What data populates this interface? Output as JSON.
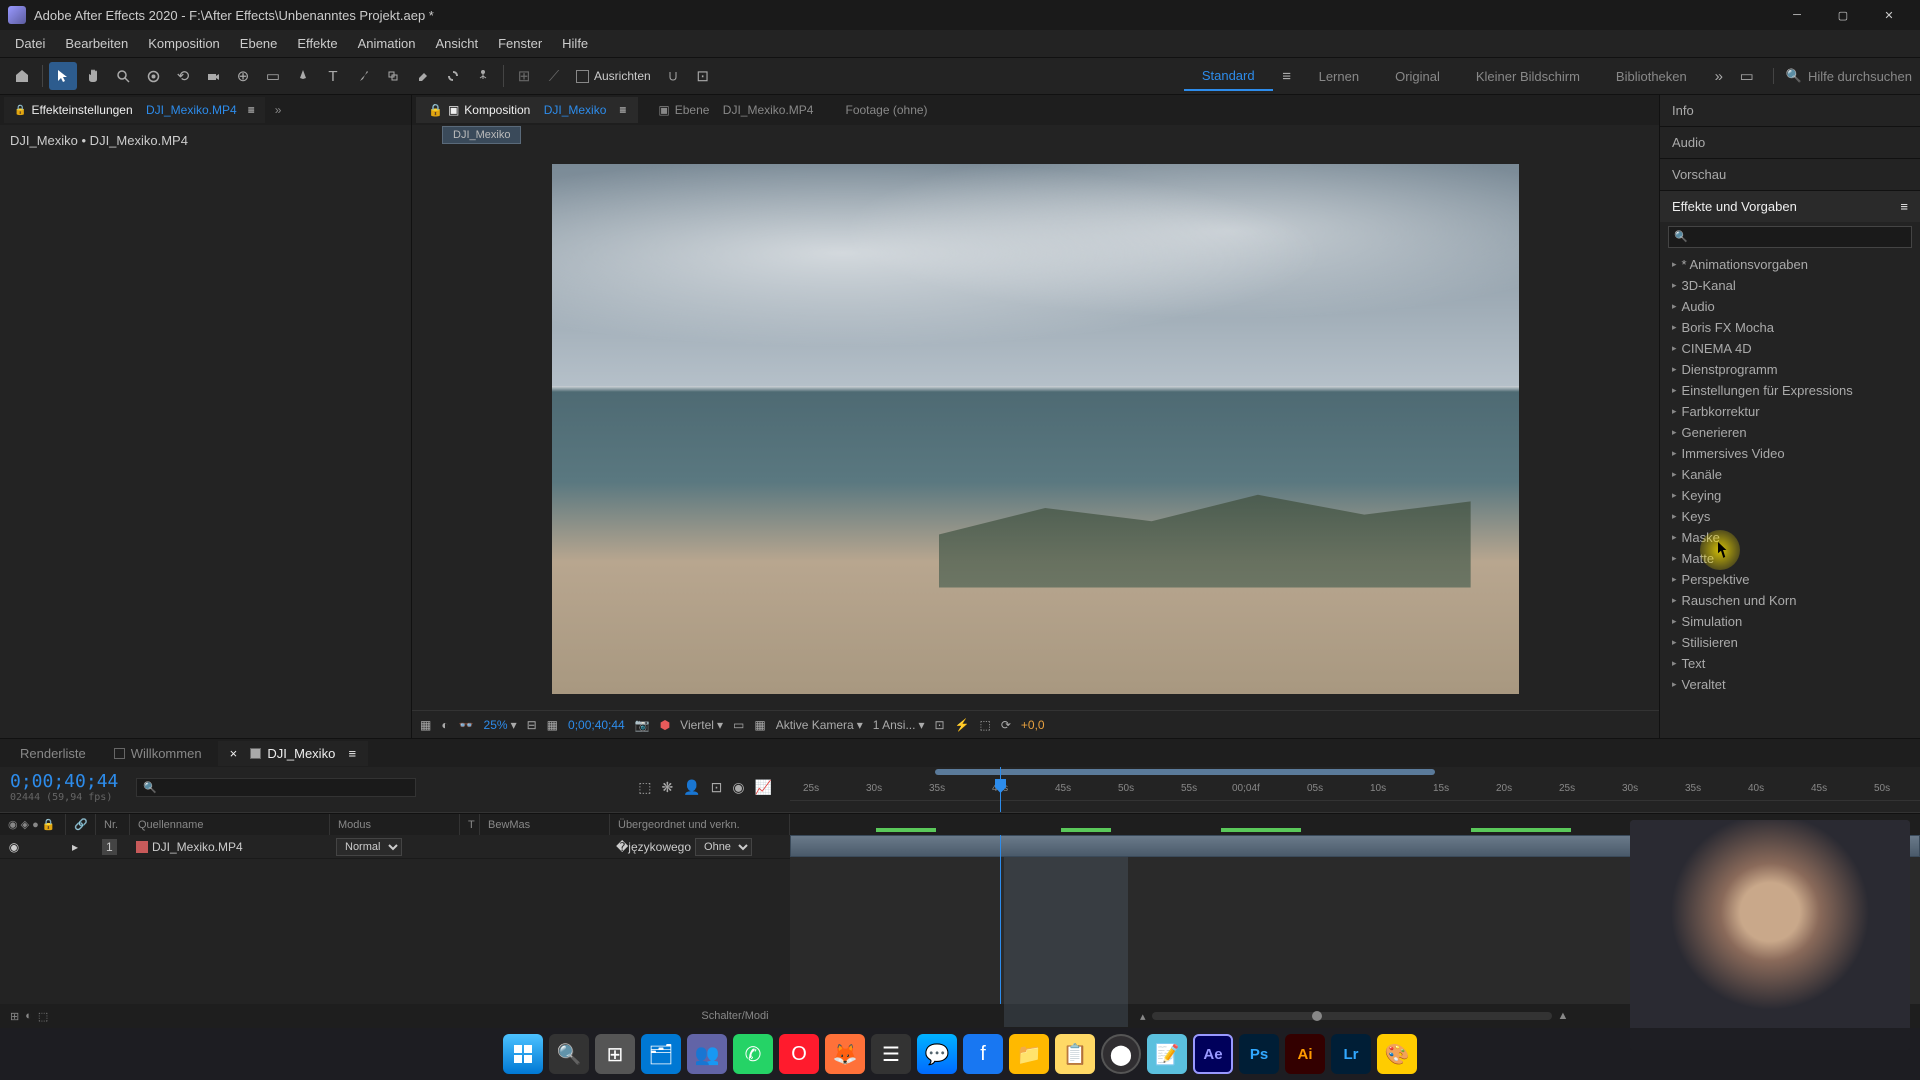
{
  "titlebar": {
    "title": "Adobe After Effects 2020 - F:\\After Effects\\Unbenanntes Projekt.aep *"
  },
  "menu": [
    "Datei",
    "Bearbeiten",
    "Komposition",
    "Ebene",
    "Effekte",
    "Animation",
    "Ansicht",
    "Fenster",
    "Hilfe"
  ],
  "toolbar": {
    "align_label": "Ausrichten",
    "workspaces": [
      "Standard",
      "Lernen",
      "Original",
      "Kleiner Bildschirm",
      "Bibliotheken"
    ],
    "active_workspace": "Standard",
    "search_placeholder": "Hilfe durchsuchen"
  },
  "left": {
    "tab1_prefix": "Effekteinstellungen",
    "tab1_file": "DJI_Mexiko.MP4",
    "body": "DJI_Mexiko • DJI_Mexiko.MP4"
  },
  "center": {
    "tab_comp_prefix": "Komposition",
    "tab_comp_name": "DJI_Mexiko",
    "tab_layer_prefix": "Ebene",
    "tab_layer_name": "DJI_Mexiko.MP4",
    "tab_footage": "Footage  (ohne)",
    "sub_name": "DJI_Mexiko",
    "ctrl": {
      "zoom": "25%",
      "timecode": "0;00;40;44",
      "quality": "Viertel",
      "camera": "Aktive Kamera",
      "views": "1 Ansi...",
      "exposure": "+0,0"
    }
  },
  "right": {
    "info": "Info",
    "audio": "Audio",
    "preview": "Vorschau",
    "effects_title": "Effekte und Vorgaben",
    "fx": [
      "* Animationsvorgaben",
      "3D-Kanal",
      "Audio",
      "Boris FX Mocha",
      "CINEMA 4D",
      "Dienstprogramm",
      "Einstellungen für Expressions",
      "Farbkorrektur",
      "Generieren",
      "Immersives Video",
      "Kanäle",
      "Keying",
      "Keys",
      "Maske",
      "Matte",
      "Perspektive",
      "Rauschen und Korn",
      "Simulation",
      "Stilisieren",
      "Text",
      "Veraltet"
    ]
  },
  "timeline": {
    "tabs": {
      "render": "Renderliste",
      "welcome": "Willkommen",
      "comp": "DJI_Mexiko"
    },
    "timecode": "0;00;40;44",
    "subcode": "02444 (59,94 fps)",
    "cols": {
      "nr": "Nr.",
      "source": "Quellenname",
      "mode": "Modus",
      "t": "T",
      "bew": "BewMas",
      "parent": "Übergeordnet und verkn."
    },
    "layer": {
      "num": "1",
      "name": "DJI_Mexiko.MP4",
      "mode": "Normal",
      "parent": "Ohne"
    },
    "ticks": [
      "25s",
      "30s",
      "35s",
      "40s",
      "45s",
      "50s",
      "55s",
      "00;04f",
      "05s",
      "10s",
      "15s",
      "20s",
      "25s",
      "30s",
      "35s",
      "40s",
      "45s",
      "50s"
    ],
    "footer": "Schalter/Modi"
  },
  "taskbar_ae": "Ae",
  "taskbar_ps": "Ps",
  "taskbar_ai": "Ai",
  "taskbar_lr": "Lr"
}
